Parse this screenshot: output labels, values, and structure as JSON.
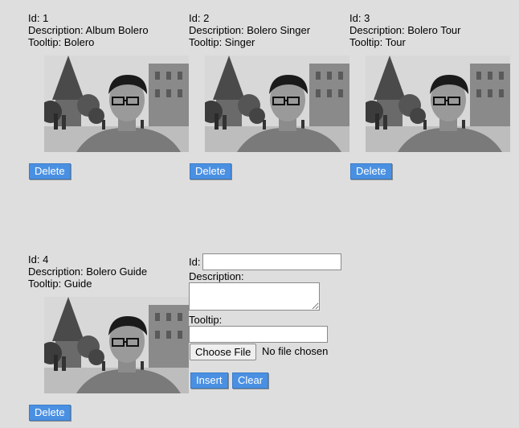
{
  "records": [
    {
      "id_line": "Id: 1",
      "desc_line": "Description: Album Bolero",
      "tip_line": "Tooltip: Bolero",
      "delete_label": "Delete"
    },
    {
      "id_line": "Id: 2",
      "desc_line": "Description: Bolero Singer",
      "tip_line": "Tooltip: Singer",
      "delete_label": "Delete"
    },
    {
      "id_line": "Id: 3",
      "desc_line": "Description: Bolero Tour",
      "tip_line": "Tooltip: Tour",
      "delete_label": "Delete"
    },
    {
      "id_line": "Id: 4",
      "desc_line": "Description: Bolero Guide",
      "tip_line": "Tooltip: Guide",
      "delete_label": "Delete"
    }
  ],
  "form": {
    "id_label": "Id:",
    "id_value": "",
    "description_label": "Description:",
    "description_value": "",
    "tooltip_label": "Tooltip:",
    "tooltip_value": "",
    "choose_file_label": "Choose File",
    "no_file_text": "No file chosen",
    "insert_label": "Insert",
    "clear_label": "Clear"
  },
  "colors": {
    "background": "#dedede",
    "button": "#4a90e2"
  }
}
